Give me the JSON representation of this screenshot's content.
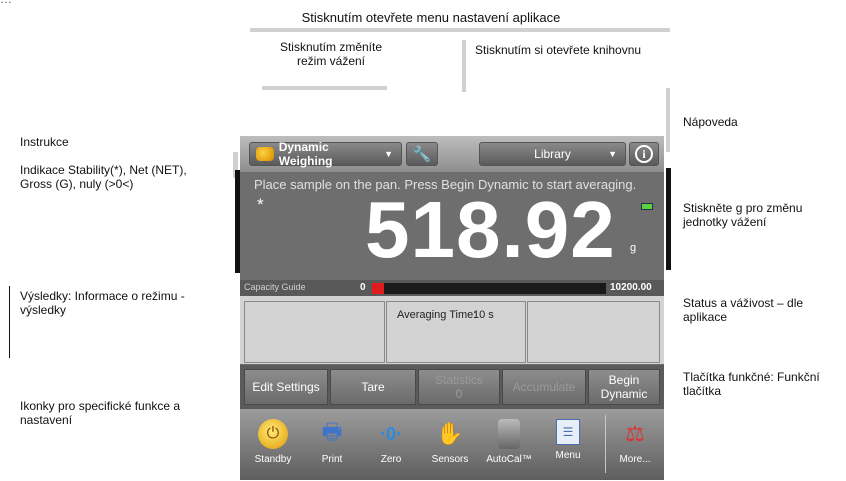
{
  "annotations": {
    "top_cut": "…",
    "app_menu": "Stisknutím otevřete menu nastavení aplikace",
    "mode": "Stisknutím změníte režim vážení",
    "library": "Stisknutím si otevřete knihovnu",
    "help": "Nápoveda",
    "instructions": "Instrukce",
    "stability": "Indikace Stability(*), Net (NET), Gross (G), nuly (>0<)",
    "unit": "Stiskněte g pro změnu jednotky vážení",
    "results": "Výsledky: Informace o režimu - výsledky",
    "status": "Status a váživost – dle aplikace",
    "function_buttons": "Tlačítka funkčné: Funkční tlačítka",
    "icons": "Ikonky pro specifické funkce a nastavení"
  },
  "device": {
    "mode": "Dynamic Weighing",
    "library": "Library",
    "instruction": "Place sample on the pan.  Press Begin Dynamic to start averaging.",
    "stability_symbol": "*",
    "reading": "518.92",
    "unit": "g",
    "capacity": {
      "label": "Capacity Guide",
      "min": "0",
      "max": "10200.00",
      "fill_percent": 5
    },
    "results": {
      "averaging_label": "Averaging Time:",
      "averaging_value": "10 s"
    },
    "buttons": {
      "edit_settings": "Edit Settings",
      "tare": "Tare",
      "statistics": "Statistics",
      "statistics_count": "0",
      "accumulate": "Accumulate",
      "begin_line1": "Begin",
      "begin_line2": "Dynamic"
    },
    "icons": [
      {
        "label": "Standby",
        "icon": "power-icon"
      },
      {
        "label": "Print",
        "icon": "printer-icon"
      },
      {
        "label": "Zero",
        "icon": "zero-icon"
      },
      {
        "label": "Sensors",
        "icon": "hand-sensor-icon"
      },
      {
        "label": "AutoCal™",
        "icon": "weight-icon"
      },
      {
        "label": "Menu",
        "icon": "menu-icon"
      },
      {
        "label": "More...",
        "icon": "more-icon"
      }
    ]
  },
  "colors": {
    "capacity_fill": "#e01b1b",
    "battery": "#5bd53d"
  }
}
